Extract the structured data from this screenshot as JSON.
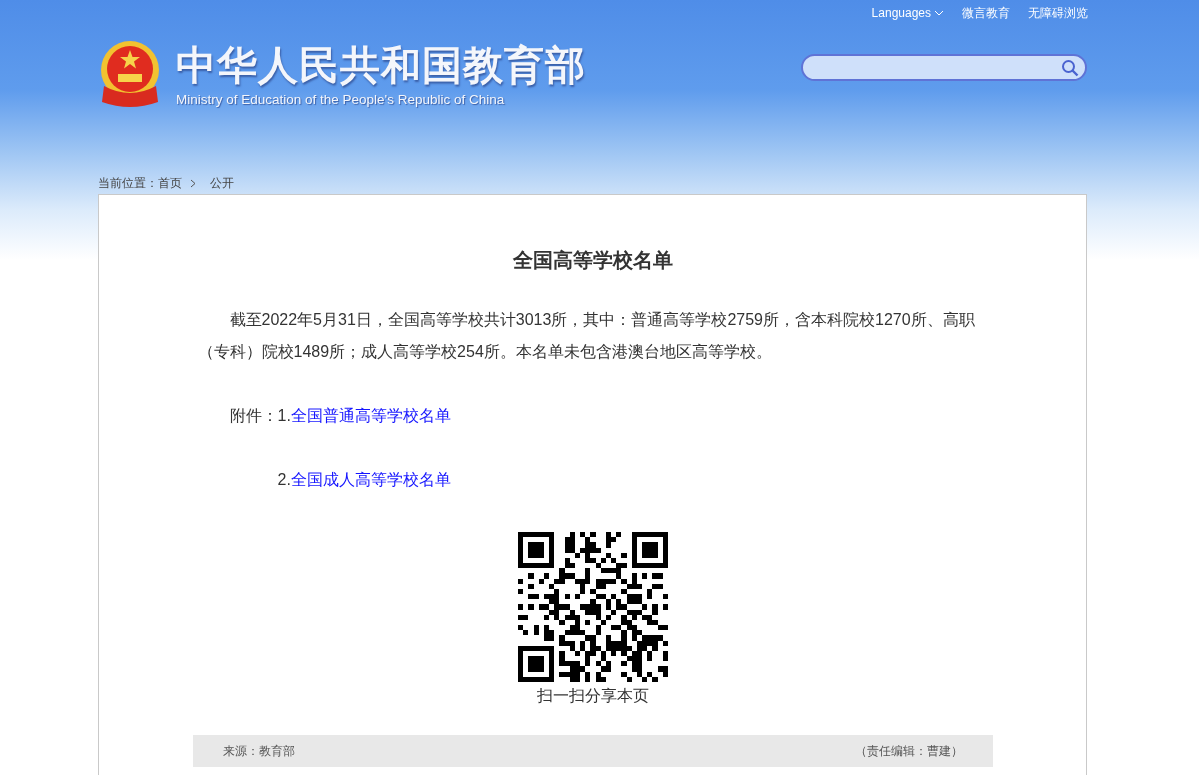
{
  "top_links": [
    {
      "label": "Languages",
      "kind": "dropdown"
    },
    {
      "label": "微言教育",
      "kind": "link"
    },
    {
      "label": "无障碍浏览",
      "kind": "link"
    }
  ],
  "logo": {
    "title": "中华人民共和国教育部",
    "subtitle": "Ministry of Education of the People's Republic of China"
  },
  "breadcrumb": {
    "prefix": "当前位置：",
    "items": [
      "首页",
      "公开"
    ]
  },
  "article": {
    "title": "全国高等学校名单",
    "paragraph": "截至2022年5月31日，全国高等学校共计3013所，其中：普通高等学校2759所，含本科院校1270所、高职（专科）院校1489所；成人高等学校254所。本名单未包含港澳台地区高等学校。",
    "attachments_label": "附件：",
    "attachments": [
      {
        "number": "1.",
        "title": "全国普通高等学校名单"
      },
      {
        "number": "2.",
        "title": "全国成人高等学校名单"
      }
    ],
    "qr_caption": "扫一扫分享本页",
    "source": "来源：教育部",
    "editor": "（责任编辑：曹建）"
  }
}
